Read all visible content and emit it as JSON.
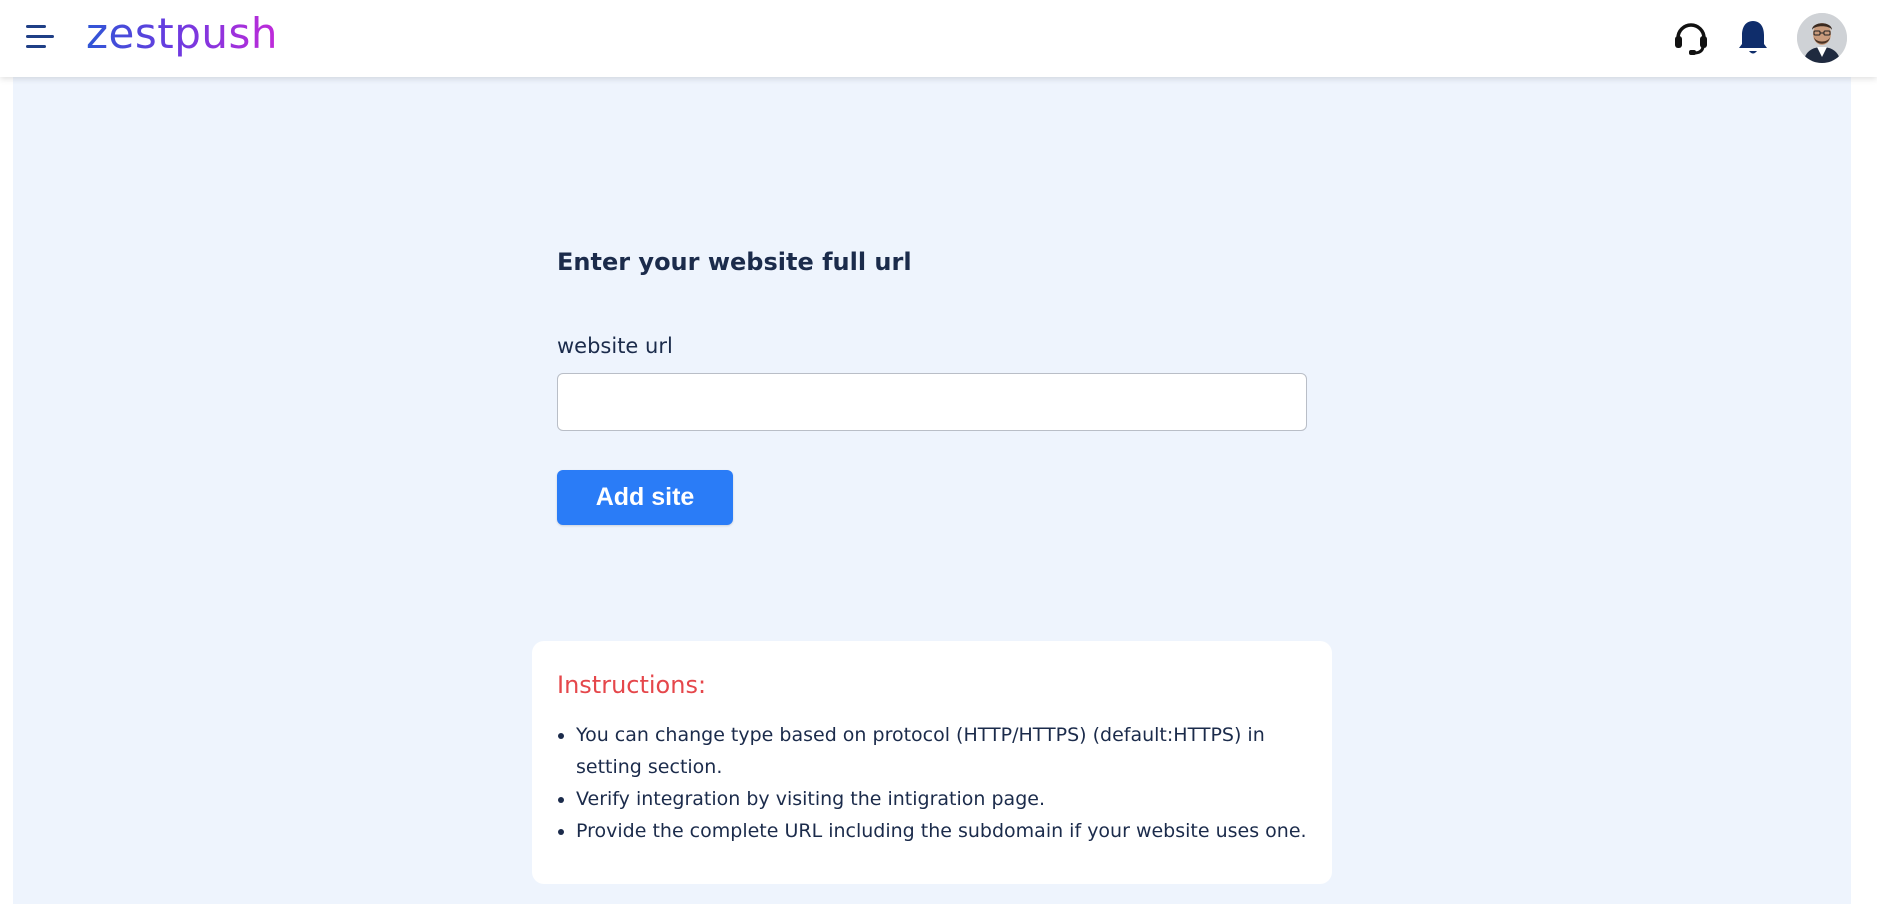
{
  "header": {
    "logo_text": "zestpush",
    "icons": [
      "menu-icon",
      "headset-icon",
      "bell-icon",
      "user-avatar"
    ]
  },
  "form": {
    "title": "Enter your website full url",
    "field_label": "website url",
    "input_value": "",
    "input_placeholder": "",
    "submit_label": "Add site"
  },
  "instructions": {
    "title": "Instructions:",
    "items": [
      "You can change type based on protocol (HTTP/HTTPS) (default:HTTPS) in setting section.",
      "Verify integration by visiting the intigration page.",
      "Provide the complete URL including the subdomain if your website uses one."
    ]
  },
  "colors": {
    "brand_start": "#2f56d6",
    "brand_end": "#c12ad9",
    "primary_button": "#2a7cf7",
    "instructions_title": "#e5474b",
    "page_background": "#eef4fd",
    "icon_navy": "#0f2d6b"
  }
}
